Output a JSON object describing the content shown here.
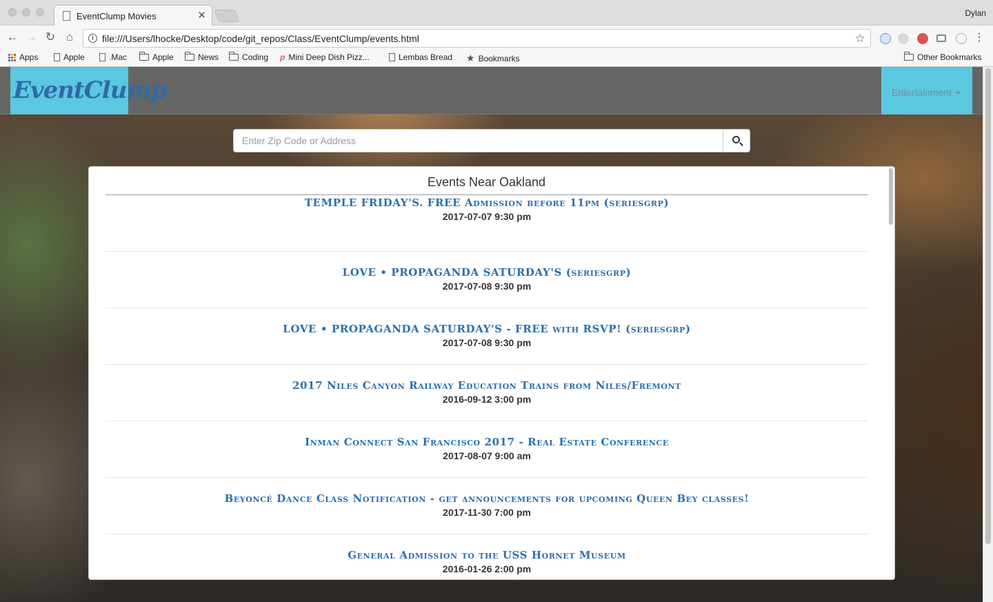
{
  "browser": {
    "tab_title": "EventClump Movies",
    "tab_close": "✕",
    "user": "Dylan",
    "url": "file:///Users/lhocke/Desktop/code/git_repos/Class/EventClump/events.html",
    "bookmarks": [
      {
        "label": "Apps",
        "icon": "apps-icon"
      },
      {
        "label": "Apple",
        "icon": "page-icon"
      },
      {
        "label": ".Mac",
        "icon": "page-icon"
      },
      {
        "label": "Apple",
        "icon": "folder-icon"
      },
      {
        "label": "News",
        "icon": "folder-icon"
      },
      {
        "label": "Coding",
        "icon": "folder-icon"
      },
      {
        "label": "Mini Deep Dish Pizz...",
        "icon": "pinterest-icon"
      },
      {
        "label": "Lembas Bread",
        "icon": "page-icon"
      },
      {
        "label": "Bookmarks",
        "icon": "star-icon"
      }
    ],
    "other_bookmarks": "Other Bookmarks"
  },
  "site": {
    "brand": "EventClump",
    "nav_dropdown": "Entertainment",
    "search_placeholder": "Enter Zip Code or Address",
    "panel_title": "Events Near Oakland"
  },
  "events": [
    {
      "title": "TEMPLE FRIDAY'S. FREE Admission before 11pm (seriesgrp)",
      "date": "2017-07-07 9:30 pm"
    },
    {
      "title": "LOVE • PROPAGANDA SATURDAY'S (seriesgrp)",
      "date": "2017-07-08 9:30 pm"
    },
    {
      "title": "LOVE • PROPAGANDA SATURDAY'S - FREE with RSVP! (seriesgrp)",
      "date": "2017-07-08 9:30 pm"
    },
    {
      "title": "2017 Niles Canyon Railway Education Trains from Niles/Fremont",
      "date": "2016-09-12 3:00 pm"
    },
    {
      "title": "Inman Connect San Francisco 2017 - Real Estate Conference",
      "date": "2017-08-07 9:00 am"
    },
    {
      "title": "Beyoncé Dance Class Notification - get announcements for upcoming Queen Bey classes!",
      "date": "2017-11-30 7:00 pm"
    },
    {
      "title": "General Admission to the USS Hornet Museum",
      "date": "2016-01-26 2:00 pm"
    }
  ],
  "colors": {
    "brand_bg": "#5bc7e0",
    "brand_text": "#2f6aa8",
    "navbar_bg": "#656565",
    "event_link": "#2a6fad"
  }
}
